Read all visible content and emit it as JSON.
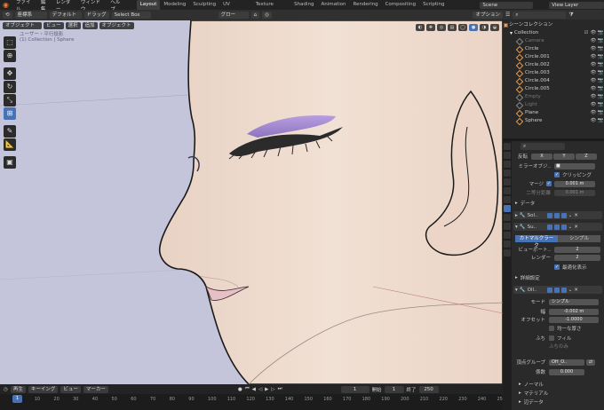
{
  "topbar": {
    "menus": [
      "ファイル",
      "編集",
      "レンダー",
      "ウィンドウ",
      "ヘルプ"
    ],
    "workspaces": [
      "Layout",
      "Modeling",
      "Sculpting",
      "UV Editing",
      "Texture Paint",
      "Shading",
      "Animation",
      "Rendering",
      "Compositing",
      "Scripting"
    ],
    "active_workspace": "Layout",
    "scene": "Scene",
    "view_layer": "View Layer"
  },
  "header": {
    "transform_label": "座標系",
    "pivot": "デフォルト",
    "drag_label": "ドラッグ",
    "select_mode": "Select Box",
    "snap_label": "グロー",
    "options": "オプション"
  },
  "viewport": {
    "mode": "オブジェクト",
    "menus": [
      "ビュー",
      "選択",
      "追加",
      "オブジェクト"
    ],
    "overlay_line1": "ユーザー・平行投影",
    "overlay_line2": "(1) Collection | Sphere"
  },
  "timeline": {
    "playback": "再生",
    "keying": "キーイング",
    "view": "ビュー",
    "marker": "マーカー",
    "current_frame": "1",
    "start_label": "開始",
    "start": "1",
    "end_label": "終了",
    "end": "250",
    "ticks": [
      "1",
      "10",
      "20",
      "30",
      "40",
      "50",
      "60",
      "70",
      "80",
      "90",
      "100",
      "110",
      "120",
      "130",
      "140",
      "150",
      "160",
      "170",
      "180",
      "190",
      "200",
      "210",
      "220",
      "230",
      "240",
      "250"
    ]
  },
  "outliner": {
    "title": "シーンコレクション",
    "collection": "Collection",
    "items": [
      {
        "name": "Camera",
        "color": "#888888",
        "dim": true
      },
      {
        "name": "Circle",
        "color": "#e89a4e",
        "dim": false
      },
      {
        "name": "Circle.001",
        "color": "#e89a4e",
        "dim": false
      },
      {
        "name": "Circle.002",
        "color": "#e89a4e",
        "dim": false
      },
      {
        "name": "Circle.003",
        "color": "#e89a4e",
        "dim": false
      },
      {
        "name": "Circle.004",
        "color": "#e89a4e",
        "dim": false
      },
      {
        "name": "Circle.005",
        "color": "#e89a4e",
        "dim": false
      },
      {
        "name": "Empty",
        "color": "#888888",
        "dim": true
      },
      {
        "name": "Light",
        "color": "#888888",
        "dim": true
      },
      {
        "name": "Plane",
        "color": "#e89a4e",
        "dim": false
      },
      {
        "name": "Sphere",
        "color": "#e89a4e",
        "dim": false
      }
    ]
  },
  "properties": {
    "axis_label": "反転",
    "axes": [
      "X",
      "Y",
      "Z"
    ],
    "mirror_object": "ミラーオブジ..",
    "clipping": "クリッピング",
    "merge": "マージ",
    "merge_value": "0.001 m",
    "bisect_distance": "二等分距離",
    "bisect_value": "0.001 m",
    "data": "データ",
    "mod1": "Sol..",
    "mod2": "Su..",
    "catmull": "カトマルクラーク",
    "simple": "シンプル",
    "viewport_levels": "ビューポート..",
    "viewport_levels_value": "2",
    "render": "レンダー",
    "render_value": "2",
    "optimal": "最適化表示",
    "advanced": "詳細設定",
    "mod3": "Oll..",
    "mode_label": "モード",
    "mode_value": "シンプル",
    "width_label": "幅",
    "width_value": "-0.002 m",
    "offset_label": "オフセット",
    "offset_value": "-1.0000",
    "even_thickness": "均一な厚さ",
    "rim_label": "ふち",
    "fill": "フィル",
    "rim_only": "ふちのみ",
    "vgroup_label": "頂点グループ",
    "vgroup_value": "OH_O..",
    "factor_label": "係数",
    "factor_value": "0.000",
    "normal": "ノーマル",
    "material": "マテリアル",
    "shell_data": "辺データ"
  },
  "colors": {
    "accent": "#4772b3",
    "viewport_bg": "#c4c5db",
    "skin": "#f0ddd0",
    "eyeliner": "#9a83c8"
  }
}
